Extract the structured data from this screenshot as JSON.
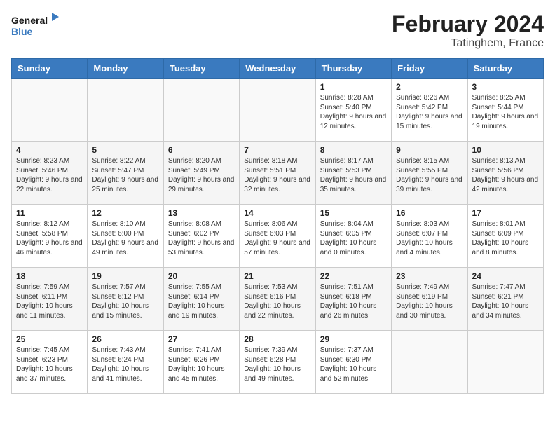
{
  "logo": {
    "line1": "General",
    "line2": "Blue"
  },
  "title": "February 2024",
  "subtitle": "Tatinghem, France",
  "days_of_week": [
    "Sunday",
    "Monday",
    "Tuesday",
    "Wednesday",
    "Thursday",
    "Friday",
    "Saturday"
  ],
  "weeks": [
    [
      {
        "day": "",
        "info": ""
      },
      {
        "day": "",
        "info": ""
      },
      {
        "day": "",
        "info": ""
      },
      {
        "day": "",
        "info": ""
      },
      {
        "day": "1",
        "info": "Sunrise: 8:28 AM\nSunset: 5:40 PM\nDaylight: 9 hours and 12 minutes."
      },
      {
        "day": "2",
        "info": "Sunrise: 8:26 AM\nSunset: 5:42 PM\nDaylight: 9 hours and 15 minutes."
      },
      {
        "day": "3",
        "info": "Sunrise: 8:25 AM\nSunset: 5:44 PM\nDaylight: 9 hours and 19 minutes."
      }
    ],
    [
      {
        "day": "4",
        "info": "Sunrise: 8:23 AM\nSunset: 5:46 PM\nDaylight: 9 hours and 22 minutes."
      },
      {
        "day": "5",
        "info": "Sunrise: 8:22 AM\nSunset: 5:47 PM\nDaylight: 9 hours and 25 minutes."
      },
      {
        "day": "6",
        "info": "Sunrise: 8:20 AM\nSunset: 5:49 PM\nDaylight: 9 hours and 29 minutes."
      },
      {
        "day": "7",
        "info": "Sunrise: 8:18 AM\nSunset: 5:51 PM\nDaylight: 9 hours and 32 minutes."
      },
      {
        "day": "8",
        "info": "Sunrise: 8:17 AM\nSunset: 5:53 PM\nDaylight: 9 hours and 35 minutes."
      },
      {
        "day": "9",
        "info": "Sunrise: 8:15 AM\nSunset: 5:55 PM\nDaylight: 9 hours and 39 minutes."
      },
      {
        "day": "10",
        "info": "Sunrise: 8:13 AM\nSunset: 5:56 PM\nDaylight: 9 hours and 42 minutes."
      }
    ],
    [
      {
        "day": "11",
        "info": "Sunrise: 8:12 AM\nSunset: 5:58 PM\nDaylight: 9 hours and 46 minutes."
      },
      {
        "day": "12",
        "info": "Sunrise: 8:10 AM\nSunset: 6:00 PM\nDaylight: 9 hours and 49 minutes."
      },
      {
        "day": "13",
        "info": "Sunrise: 8:08 AM\nSunset: 6:02 PM\nDaylight: 9 hours and 53 minutes."
      },
      {
        "day": "14",
        "info": "Sunrise: 8:06 AM\nSunset: 6:03 PM\nDaylight: 9 hours and 57 minutes."
      },
      {
        "day": "15",
        "info": "Sunrise: 8:04 AM\nSunset: 6:05 PM\nDaylight: 10 hours and 0 minutes."
      },
      {
        "day": "16",
        "info": "Sunrise: 8:03 AM\nSunset: 6:07 PM\nDaylight: 10 hours and 4 minutes."
      },
      {
        "day": "17",
        "info": "Sunrise: 8:01 AM\nSunset: 6:09 PM\nDaylight: 10 hours and 8 minutes."
      }
    ],
    [
      {
        "day": "18",
        "info": "Sunrise: 7:59 AM\nSunset: 6:11 PM\nDaylight: 10 hours and 11 minutes."
      },
      {
        "day": "19",
        "info": "Sunrise: 7:57 AM\nSunset: 6:12 PM\nDaylight: 10 hours and 15 minutes."
      },
      {
        "day": "20",
        "info": "Sunrise: 7:55 AM\nSunset: 6:14 PM\nDaylight: 10 hours and 19 minutes."
      },
      {
        "day": "21",
        "info": "Sunrise: 7:53 AM\nSunset: 6:16 PM\nDaylight: 10 hours and 22 minutes."
      },
      {
        "day": "22",
        "info": "Sunrise: 7:51 AM\nSunset: 6:18 PM\nDaylight: 10 hours and 26 minutes."
      },
      {
        "day": "23",
        "info": "Sunrise: 7:49 AM\nSunset: 6:19 PM\nDaylight: 10 hours and 30 minutes."
      },
      {
        "day": "24",
        "info": "Sunrise: 7:47 AM\nSunset: 6:21 PM\nDaylight: 10 hours and 34 minutes."
      }
    ],
    [
      {
        "day": "25",
        "info": "Sunrise: 7:45 AM\nSunset: 6:23 PM\nDaylight: 10 hours and 37 minutes."
      },
      {
        "day": "26",
        "info": "Sunrise: 7:43 AM\nSunset: 6:24 PM\nDaylight: 10 hours and 41 minutes."
      },
      {
        "day": "27",
        "info": "Sunrise: 7:41 AM\nSunset: 6:26 PM\nDaylight: 10 hours and 45 minutes."
      },
      {
        "day": "28",
        "info": "Sunrise: 7:39 AM\nSunset: 6:28 PM\nDaylight: 10 hours and 49 minutes."
      },
      {
        "day": "29",
        "info": "Sunrise: 7:37 AM\nSunset: 6:30 PM\nDaylight: 10 hours and 52 minutes."
      },
      {
        "day": "",
        "info": ""
      },
      {
        "day": "",
        "info": ""
      }
    ]
  ]
}
